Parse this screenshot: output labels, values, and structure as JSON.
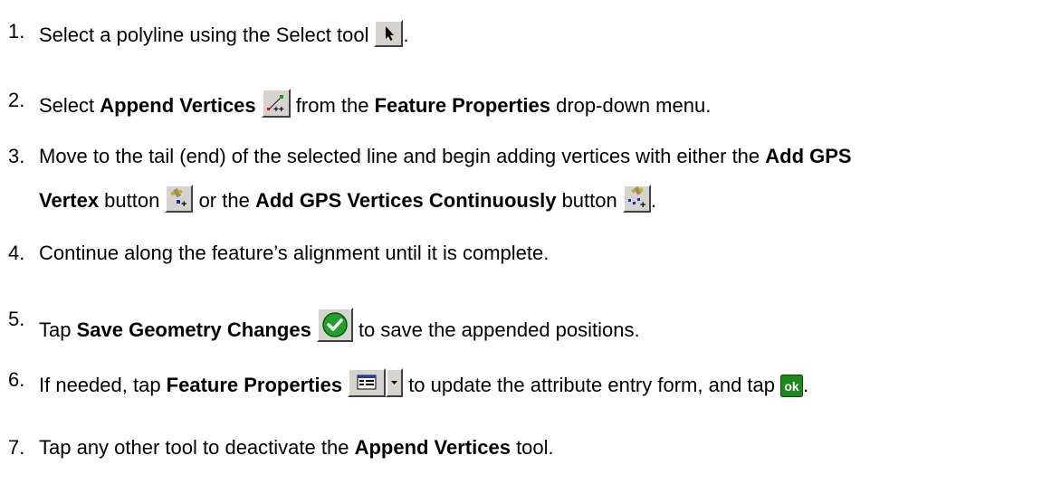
{
  "steps": [
    {
      "num": "1.",
      "t1": "Select a polyline using the Select tool",
      "icon": "select-arrow-icon",
      "t2": "."
    },
    {
      "num": "2.",
      "t1": "Select ",
      "b1": "Append Vertices",
      "icon": "append-vertices-icon",
      "t2": " from the ",
      "b2": "Feature Properties",
      "t3": " drop-down menu."
    },
    {
      "num": "3.",
      "t1": "Move to the tail (end) of the selected line and begin adding vertices with either the ",
      "b1": "Add GPS",
      "b2": "Vertex",
      "t2": " button ",
      "icon1": "add-gps-vertex-icon",
      "t3": " or the ",
      "b3": "Add GPS Vertices Continuously",
      "t4": " button ",
      "icon2": "add-gps-vertices-continuously-icon",
      "t5": "."
    },
    {
      "num": "4.",
      "t1": "Continue along the feature’s alignment until it is complete."
    },
    {
      "num": "5.",
      "t1": "Tap ",
      "b1": "Save Geometry Changes",
      "icon": "save-geometry-changes-icon",
      "t2": " to save the appended positions."
    },
    {
      "num": "6.",
      "t1": "If needed, tap ",
      "b1": "Feature Properties",
      "icon1": "feature-properties-icon",
      "icon2": "dropdown-arrow-icon",
      "t2": " to update the attribute entry form, and tap ",
      "icon3": "ok-icon",
      "ok_label": "ok",
      "t3": "."
    },
    {
      "num": "7.",
      "t1": "Tap any other tool to deactivate the ",
      "b1": "Append Vertices",
      "t2": " tool."
    }
  ],
  "colors": {
    "button_face": "#d6d3ce",
    "ok_green": "#1a8a1a",
    "save_green": "#22a02a"
  }
}
